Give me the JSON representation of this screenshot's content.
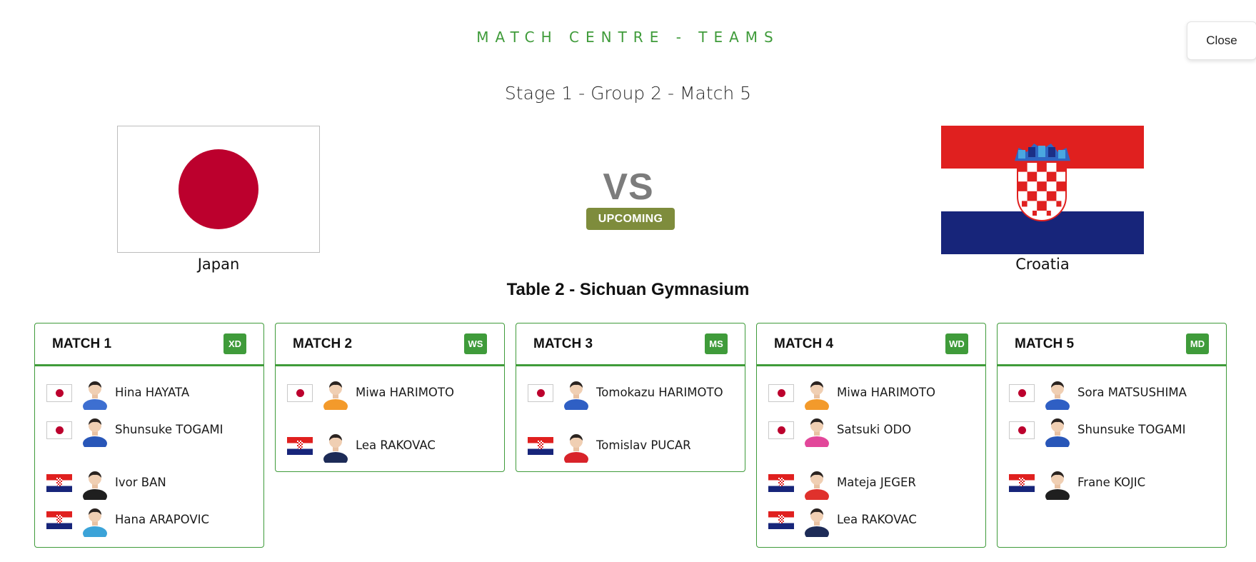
{
  "header": {
    "title": "MATCH CENTRE - TEAMS",
    "close_label": "Close"
  },
  "match": {
    "stage": "Stage 1 - Group 2 - Match 5",
    "vs": "VS",
    "status": "UPCOMING",
    "venue": "Table 2 - Sichuan Gymnasium"
  },
  "teams": {
    "home": {
      "name": "Japan"
    },
    "away": {
      "name": "Croatia"
    }
  },
  "colors": {
    "accent_green": "#3f9b3a",
    "status_olive": "#7e8c3c",
    "japan_red": "#bc002d",
    "croatia_red": "#e0201f",
    "croatia_blue": "#17257a"
  },
  "matches": [
    {
      "label": "MATCH 1",
      "type": "XD",
      "home": [
        {
          "name": "Hina HAYATA",
          "shirt": "#3d6fd1"
        },
        {
          "name": "Shunsuke TOGAMI",
          "shirt": "#2856b8"
        }
      ],
      "away": [
        {
          "name": "Ivor BAN",
          "shirt": "#1f1f1f"
        },
        {
          "name": "Hana ARAPOVIC",
          "shirt": "#3ba3d8"
        }
      ]
    },
    {
      "label": "MATCH 2",
      "type": "WS",
      "home": [
        {
          "name": "Miwa HARIMOTO",
          "shirt": "#f39a2b"
        }
      ],
      "away": [
        {
          "name": "Lea RAKOVAC",
          "shirt": "#1d2b57"
        }
      ]
    },
    {
      "label": "MATCH 3",
      "type": "MS",
      "home": [
        {
          "name": "Tomokazu HARIMOTO",
          "shirt": "#2f5fc4"
        }
      ],
      "away": [
        {
          "name": "Tomislav PUCAR",
          "shirt": "#d8232a"
        }
      ]
    },
    {
      "label": "MATCH 4",
      "type": "WD",
      "home": [
        {
          "name": "Miwa HARIMOTO",
          "shirt": "#f39a2b"
        },
        {
          "name": "Satsuki ODO",
          "shirt": "#e2479a"
        }
      ],
      "away": [
        {
          "name": "Mateja JEGER",
          "shirt": "#e0312c"
        },
        {
          "name": "Lea RAKOVAC",
          "shirt": "#1d2b57"
        }
      ]
    },
    {
      "label": "MATCH 5",
      "type": "MD",
      "home": [
        {
          "name": "Sora MATSUSHIMA",
          "shirt": "#2f5fc4"
        },
        {
          "name": "Shunsuke TOGAMI",
          "shirt": "#2856b8"
        }
      ],
      "away": [
        {
          "name": "Frane KOJIC",
          "shirt": "#1f1f1f"
        }
      ]
    }
  ]
}
